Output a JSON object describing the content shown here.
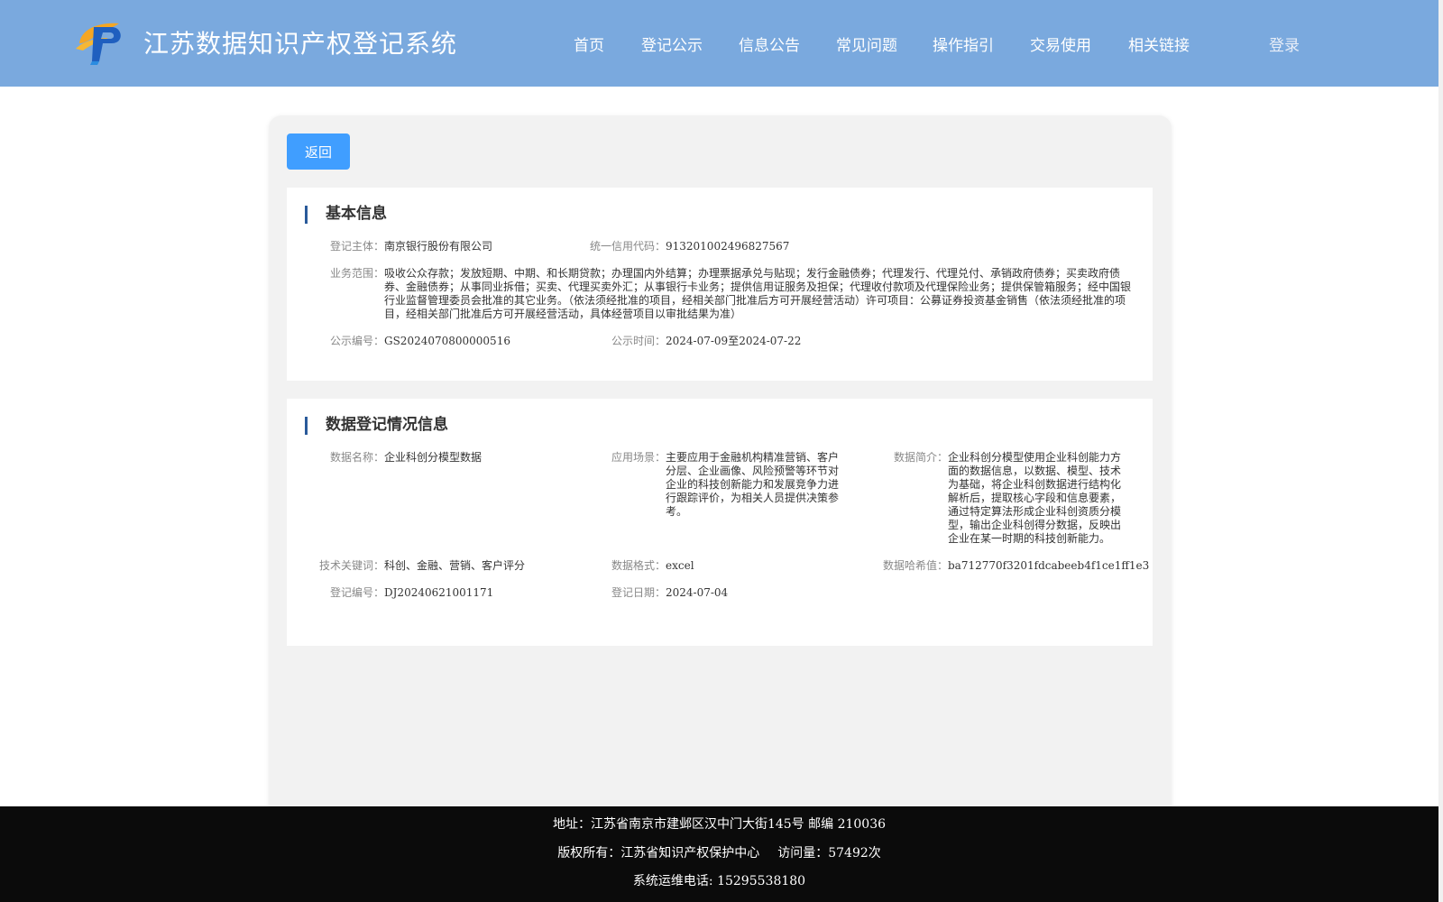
{
  "header": {
    "title": "江苏数据知识产权登记系统",
    "nav": [
      "首页",
      "登记公示",
      "信息公告",
      "常见问题",
      "操作指引",
      "交易使用",
      "相关链接"
    ],
    "login": "登录",
    "logo_icon": "logo-icon"
  },
  "back_button": "返回",
  "basic_info": {
    "title": "基本信息",
    "fields": {
      "entity_label": "登记主体：",
      "entity_value": "南京银行股份有限公司",
      "credit_label": "统一信用代码：",
      "credit_value": "913201002496827567",
      "scope_label": "业务范围：",
      "scope_value": "吸收公众存款；发放短期、中期、和长期贷款；办理国内外结算；办理票据承兑与贴现；发行金融债券；代理发行、代理兑付、承销政府债券；买卖政府债券、金融债券；从事同业拆借；买卖、代理买卖外汇；从事银行卡业务；提供信用证服务及担保；代理收付款项及代理保险业务；提供保管箱服务；经中国银行业监督管理委员会批准的其它业务。（依法须经批准的项目，经相关部门批准后方可开展经营活动）许可项目：公募证券投资基金销售（依法须经批准的项目，经相关部门批准后方可开展经营活动，具体经营项目以审批结果为准）",
      "pub_no_label": "公示编号：",
      "pub_no_value": "GS2024070800000516",
      "pub_time_label": "公示时间：",
      "pub_time_value": "2024-07-09至2024-07-22"
    }
  },
  "data_info": {
    "title": "数据登记情况信息",
    "fields": {
      "name_label": "数据名称：",
      "name_value": "企业科创分模型数据",
      "scene_label": "应用场景：",
      "scene_value": "主要应用于金融机构精准营销、客户分层、企业画像、风险预警等环节对企业的科技创新能力和发展竞争力进行跟踪评价，为相关人员提供决策参考。",
      "intro_label": "数据简介：",
      "intro_value": "企业科创分模型使用企业科创能力方面的数据信息，以数据、模型、技术为基础，将企业科创数据进行结构化解析后，提取核心字段和信息要素，通过特定算法形成企业科创资质分模型，输出企业科创得分数据，反映出企业在某一时期的科技创新能力。",
      "keywords_label": "技术关键词：",
      "keywords_value": "科创、金融、营销、客户评分",
      "format_label": "数据格式：",
      "format_value": "excel",
      "hash_label": "数据哈希值：",
      "hash_value": "ba712770f3201fdcabeeb4f1ce1ff1e3",
      "reg_no_label": "登记编号：",
      "reg_no_value": "DJ20240621001171",
      "reg_date_label": "登记日期：",
      "reg_date_value": "2024-07-04"
    }
  },
  "footer": {
    "address": "地址：江苏省南京市建邺区汉中门大街145号 邮编 210036",
    "copyright": "版权所有：江苏省知识产权保护中心",
    "visits": "访问量：57492次",
    "phone": "系统运维电话: 15295538180"
  },
  "colors": {
    "header_bg": "#7aa9de",
    "button_blue": "#409eff",
    "title_bar": "#2a5a9a",
    "footer_bg": "#0b0b0b"
  }
}
